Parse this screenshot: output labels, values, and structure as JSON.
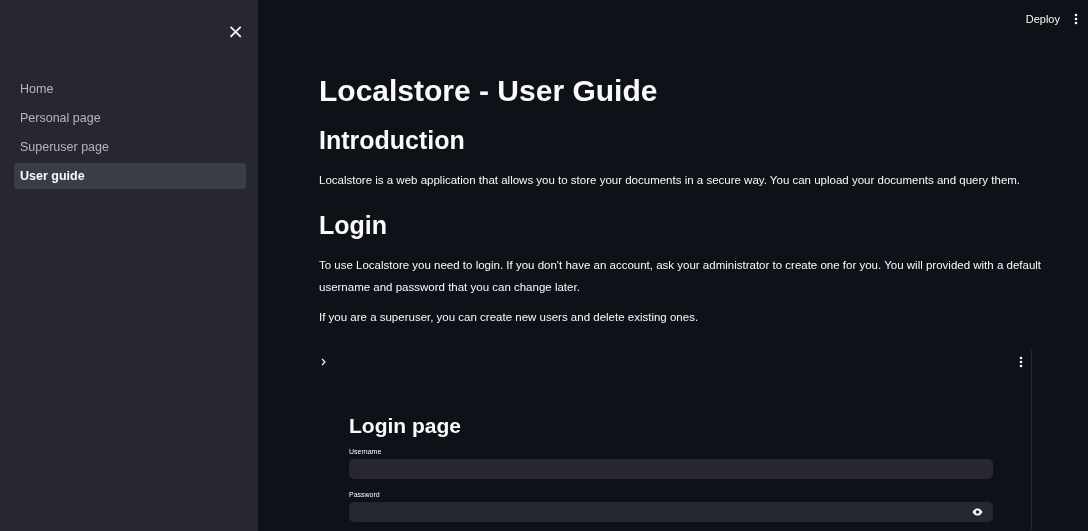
{
  "sidebar": {
    "close_label": "×",
    "items": [
      {
        "label": "Home",
        "selected": false
      },
      {
        "label": "Personal page",
        "selected": false
      },
      {
        "label": "Superuser page",
        "selected": false
      },
      {
        "label": "User guide",
        "selected": true
      }
    ]
  },
  "header": {
    "deploy": "Deploy"
  },
  "content": {
    "title": "Localstore - User Guide",
    "sections": [
      {
        "heading": "Introduction",
        "paragraphs": [
          "Localstore is a web application that allows you to store your documents in a secure way. You can upload your documents and query them."
        ]
      },
      {
        "heading": "Login",
        "paragraphs": [
          "To use Localstore you need to login. If you don't have an account, ask your administrator to create one for you. You will provided with a default username and password that you can change later.",
          "If you are a superuser, you can create new users and delete existing ones."
        ]
      }
    ],
    "embed": {
      "heading": "Login page",
      "fields": [
        {
          "label": "Username",
          "kind": "text"
        },
        {
          "label": "Password",
          "kind": "password"
        }
      ]
    }
  }
}
